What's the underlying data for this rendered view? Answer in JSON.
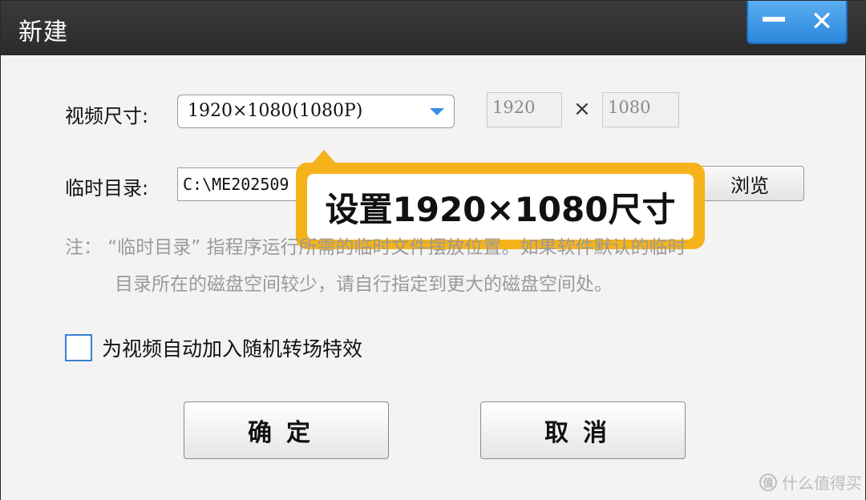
{
  "window": {
    "title": "新建",
    "minimize_glyph": "—",
    "close_glyph": "✕"
  },
  "video_size": {
    "label": "视频尺寸:",
    "selected": "1920×1080(1080P)",
    "width": "1920",
    "height": "1080",
    "times": "×"
  },
  "temp_dir": {
    "label": "临时目录:",
    "value": "C:\\ME202509",
    "browse_label": "浏览"
  },
  "callout": {
    "text": "设置1920×1080尺寸",
    "color": "#f5b21b"
  },
  "note": {
    "line1": "注：  “临时目录” 指程序运行所需的临时文件摆放位置。如果软件默认的临时",
    "line2": "目录所在的磁盘空间较少，请自行指定到更大的磁盘空间处。"
  },
  "transition": {
    "label": "为视频自动加入随机转场特效",
    "checked": false
  },
  "buttons": {
    "ok": "确定",
    "cancel": "取消"
  },
  "watermark": {
    "icon": "值",
    "text": "什么值得买"
  },
  "colors": {
    "titlebar": "#2b2b2b",
    "window_buttons": "#3a8ee6",
    "accent": "#f5b21b"
  }
}
